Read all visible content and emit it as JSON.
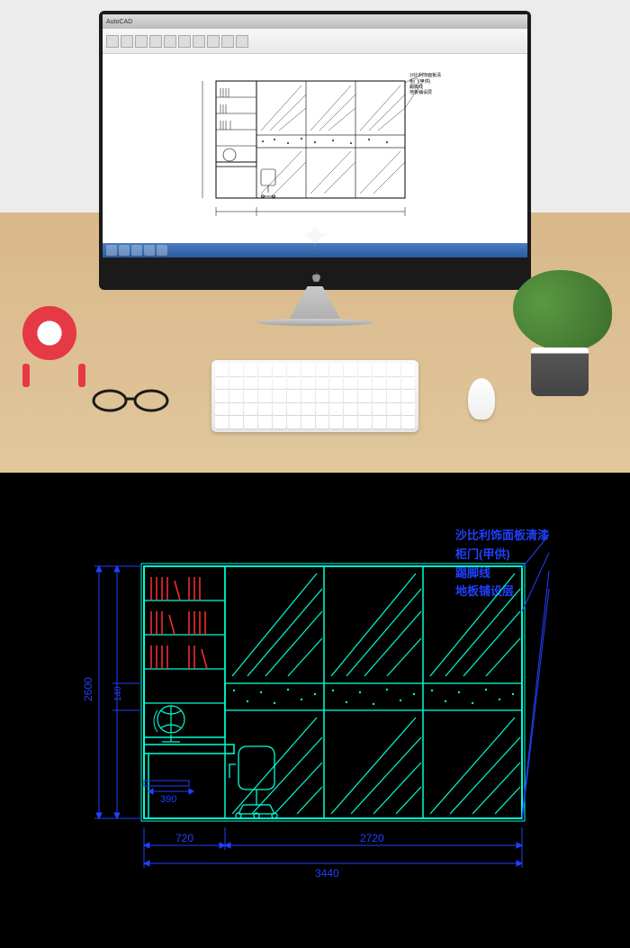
{
  "app": {
    "title": "AutoCAD"
  },
  "annotations": {
    "line1": "沙比利饰面板清漆",
    "line2": "柜门(甲供)",
    "line3": "踢脚线",
    "line4": "地板铺设层"
  },
  "dimensions": {
    "width_total": "3440",
    "seg_left": "720",
    "seg_right": "2720",
    "desk_width": "390",
    "height_total": "2600",
    "h_seg1": "140"
  },
  "colors": {
    "cad_cyan": "#00ffd4",
    "cad_blue": "#2040ff",
    "cad_red": "#ff3030",
    "clock_red": "#e63946"
  }
}
